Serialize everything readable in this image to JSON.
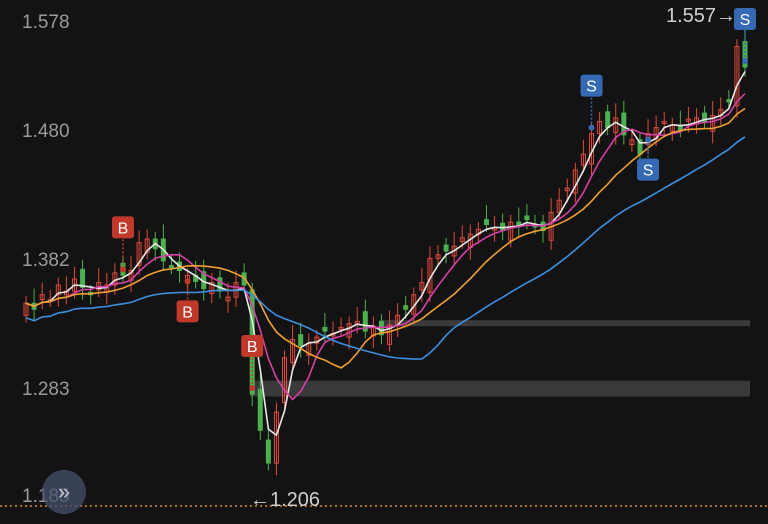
{
  "y_axis_labels": [
    "1.578",
    "1.480",
    "1.382",
    "1.283",
    "1.185"
  ],
  "high_label": "1.557→",
  "low_label": "←1.206",
  "colors": {
    "up": "#e0493c",
    "down": "#4caf50",
    "ma_white": "#e8e8e8",
    "ma_magenta": "#d63fa8",
    "ma_orange": "#f0a030",
    "ma_blue": "#3d8fe0",
    "buy": "#c0392b",
    "sell": "#3569b3",
    "dotted_line": "#e08a2a"
  },
  "fab_icon": "double-chevron-right-icon",
  "chart_data": {
    "type": "candlestick",
    "ylim": [
      1.185,
      1.578
    ],
    "y_ticks": [
      1.578,
      1.48,
      1.382,
      1.283,
      1.185
    ],
    "closes": [
      1.345,
      1.34,
      1.352,
      1.348,
      1.36,
      1.355,
      1.365,
      1.358,
      1.352,
      1.362,
      1.36,
      1.37,
      1.368,
      1.372,
      1.395,
      1.398,
      1.39,
      1.38,
      1.375,
      1.372,
      1.368,
      1.363,
      1.357,
      1.362,
      1.355,
      1.35,
      1.362,
      1.36,
      1.27,
      1.24,
      1.213,
      1.255,
      1.3,
      1.315,
      1.31,
      1.312,
      1.317,
      1.322,
      1.32,
      1.325,
      1.328,
      1.33,
      1.322,
      1.326,
      1.319,
      1.327,
      1.335,
      1.34,
      1.352,
      1.362,
      1.382,
      1.385,
      1.388,
      1.392,
      1.399,
      1.402,
      1.406,
      1.41,
      1.407,
      1.405,
      1.412,
      1.409,
      1.414,
      1.408,
      1.405,
      1.42,
      1.43,
      1.44,
      1.455,
      1.468,
      1.485,
      1.495,
      1.49,
      1.498,
      1.484,
      1.48,
      1.468,
      1.485,
      1.49,
      1.495,
      1.492,
      1.488,
      1.497,
      1.498,
      1.495,
      1.5,
      1.505,
      1.512,
      1.557,
      1.54
    ],
    "buy_markers": [
      12,
      20,
      28
    ],
    "sell_markers": [
      70,
      77,
      89
    ],
    "high": 1.557,
    "low": 1.206,
    "support_zones": [
      [
        1.268,
        1.281
      ],
      [
        1.327,
        1.331
      ]
    ]
  }
}
